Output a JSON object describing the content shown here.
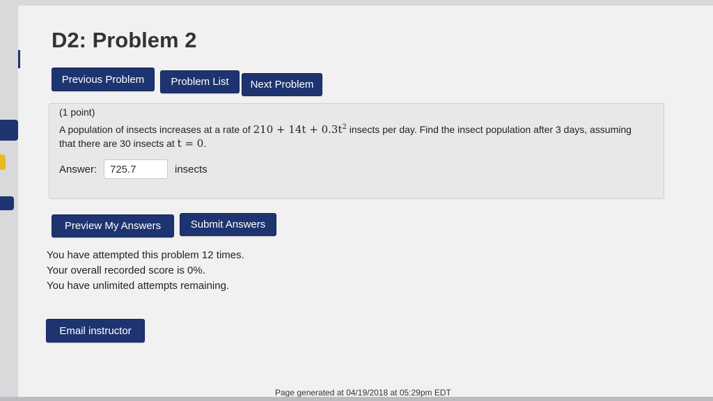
{
  "header": {
    "title": "D2: Problem 2"
  },
  "nav": {
    "previous": "Previous Problem",
    "list": "Problem List",
    "next": "Next Problem"
  },
  "problem": {
    "points": "(1 point)",
    "text_before_rate": "A population of insects increases at a rate of ",
    "rate_expression": "210 + 14t + 0.3t",
    "rate_exponent": "2",
    "text_after_rate": " insects per day. Find the insect population after 3 days, assuming",
    "text_line2_before": "that there are 30 insects at ",
    "initial_condition": "t = 0",
    "text_line2_after": "."
  },
  "answer": {
    "label": "Answer:",
    "value": "725.7",
    "units": "insects"
  },
  "actions": {
    "preview": "Preview My Answers",
    "submit": "Submit Answers"
  },
  "status": {
    "attempts": "You have attempted this problem 12 times.",
    "score": "Your overall recorded score is 0%.",
    "remaining": "You have unlimited attempts remaining."
  },
  "email": {
    "label": "Email instructor"
  },
  "footer": {
    "generated": "Page generated at 04/19/2018 at 05:29pm EDT"
  },
  "colors": {
    "button": "#1e3470",
    "accent_yellow": "#e8b923",
    "page_bg": "#f1f1f2",
    "problem_bg": "#e8e8ea"
  }
}
